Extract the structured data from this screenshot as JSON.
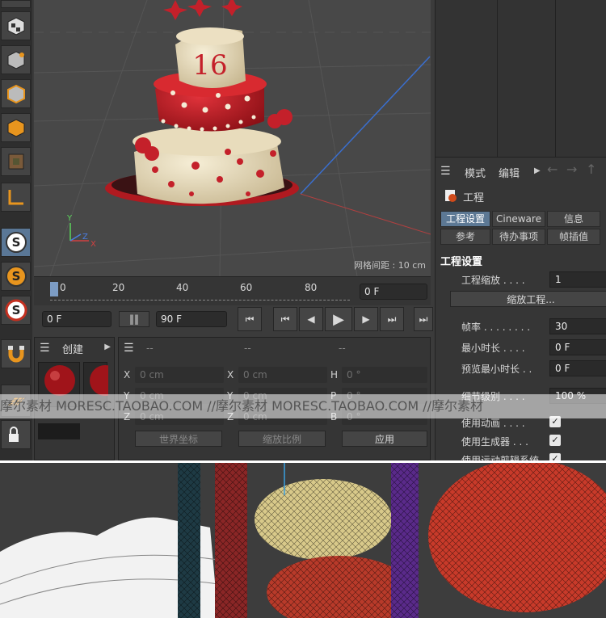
{
  "viewport": {
    "grid_spacing": "网格间距 : 10 cm",
    "axis_y": "Y",
    "axis_x": "X",
    "axis_z": "Z",
    "cake_number": "16"
  },
  "timeline": {
    "ticks": [
      "0",
      "20",
      "40",
      "60",
      "80"
    ],
    "current_frame": "0 F",
    "start_frame": "0 F",
    "end_frame": "90 F"
  },
  "material_panel": {
    "menu_icon": "hamburger-icon",
    "create_label": "创建"
  },
  "coords": {
    "header_dashes": [
      "--",
      "--",
      "--"
    ],
    "rows": [
      {
        "a": "X",
        "a_val": "0 cm",
        "b": "X",
        "b_val": "0 cm",
        "c": "H",
        "c_val": "0 °"
      },
      {
        "a": "Y",
        "a_val": "0 cm",
        "b": "Y",
        "b_val": "0 cm",
        "c": "P",
        "c_val": "0 °"
      },
      {
        "a": "Z",
        "a_val": "0 cm",
        "b": "Z",
        "b_val": "0 cm",
        "c": "B",
        "c_val": "0 °"
      }
    ],
    "world_coords": "世界坐标",
    "scale": "缩放比例",
    "apply": "应用"
  },
  "attributes": {
    "mode": "模式",
    "edit": "编辑",
    "object": "工程",
    "tabs_row1": [
      "工程设置",
      "Cineware",
      "信息"
    ],
    "tabs_row2": [
      "参考",
      "待办事项",
      "帧插值"
    ],
    "section": "工程设置",
    "props": [
      {
        "label": "工程缩放 . . . .",
        "value": "1"
      },
      {
        "label": "帧率 . . . . . . . .",
        "value": "30"
      },
      {
        "label": "最小时长 . . . .",
        "value": "0 F"
      },
      {
        "label": "预览最小时长 . .",
        "value": "0 F"
      },
      {
        "label": "细节级别 . . . .",
        "value": "100 %"
      }
    ],
    "scale_project_btn": "缩放工程...",
    "checks": [
      {
        "label": "使用动画 . . . .",
        "checked": true
      },
      {
        "label": "使用生成器 . . .",
        "checked": true
      },
      {
        "label": "使用运动剪辑系统",
        "checked": true
      }
    ]
  },
  "watermark": "摩尔素材 MORESC.TAOBAO.COM   //摩尔素材 MORESC.TAOBAO.COM   //摩尔素材",
  "colors": {
    "accent": "#5c7894",
    "cake_red": "#c4202a",
    "cake_cream": "#efe4c8",
    "orange_icon": "#e8951e"
  }
}
